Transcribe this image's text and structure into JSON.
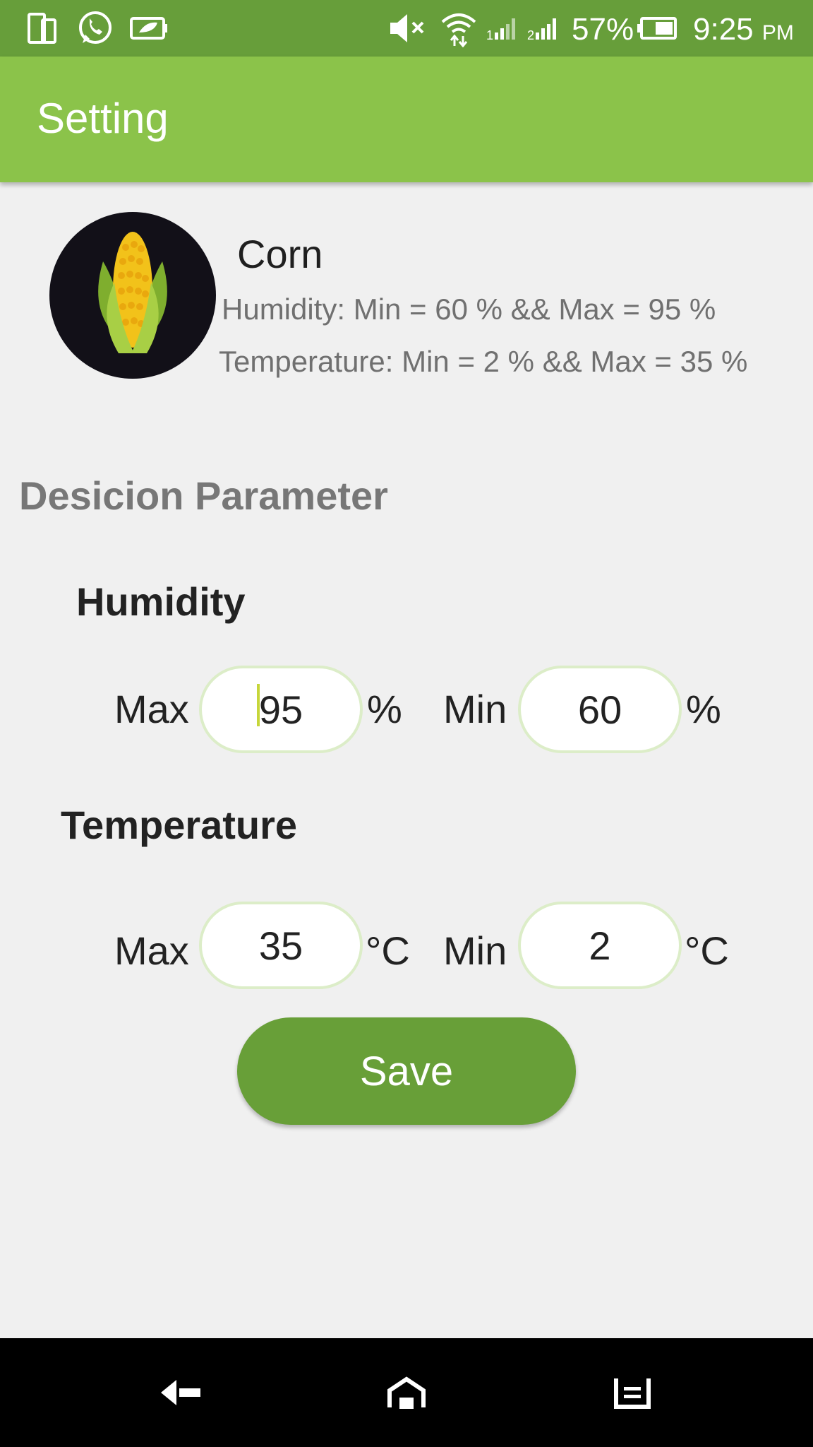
{
  "status_bar": {
    "battery_percent": "57%",
    "time": "9:25",
    "ampm": "PM",
    "icons": [
      "phone-tablet-icon",
      "whatsapp-icon",
      "battery-saver-icon",
      "mute-icon",
      "wifi-icon",
      "signal-icon",
      "signal-2-icon",
      "battery-icon"
    ]
  },
  "app_bar": {
    "title": "Setting"
  },
  "crop": {
    "name": "Corn",
    "humidity_range": "Humidity: Min = 60 % && Max = 95 %",
    "temperature_range": "Temperature: Min = 2 % && Max = 35 %",
    "icon": "corn-icon"
  },
  "decision": {
    "title": "Desicion Parameter",
    "humidity": {
      "title": "Humidity",
      "max_label": "Max",
      "max_value": "95",
      "min_label": "Min",
      "min_value": "60",
      "unit": "%"
    },
    "temperature": {
      "title": "Temperature",
      "max_label": "Max",
      "max_value": "35",
      "min_label": "Min",
      "min_value": "2",
      "unit": "°C"
    }
  },
  "save_label": "Save",
  "nav_bar": {
    "icons": [
      "back-icon",
      "home-icon",
      "recents-icon"
    ]
  },
  "colors": {
    "status_bar": "#679e3a",
    "app_bar": "#8bc34a",
    "button": "#689f38",
    "background": "#f0f0f0"
  }
}
